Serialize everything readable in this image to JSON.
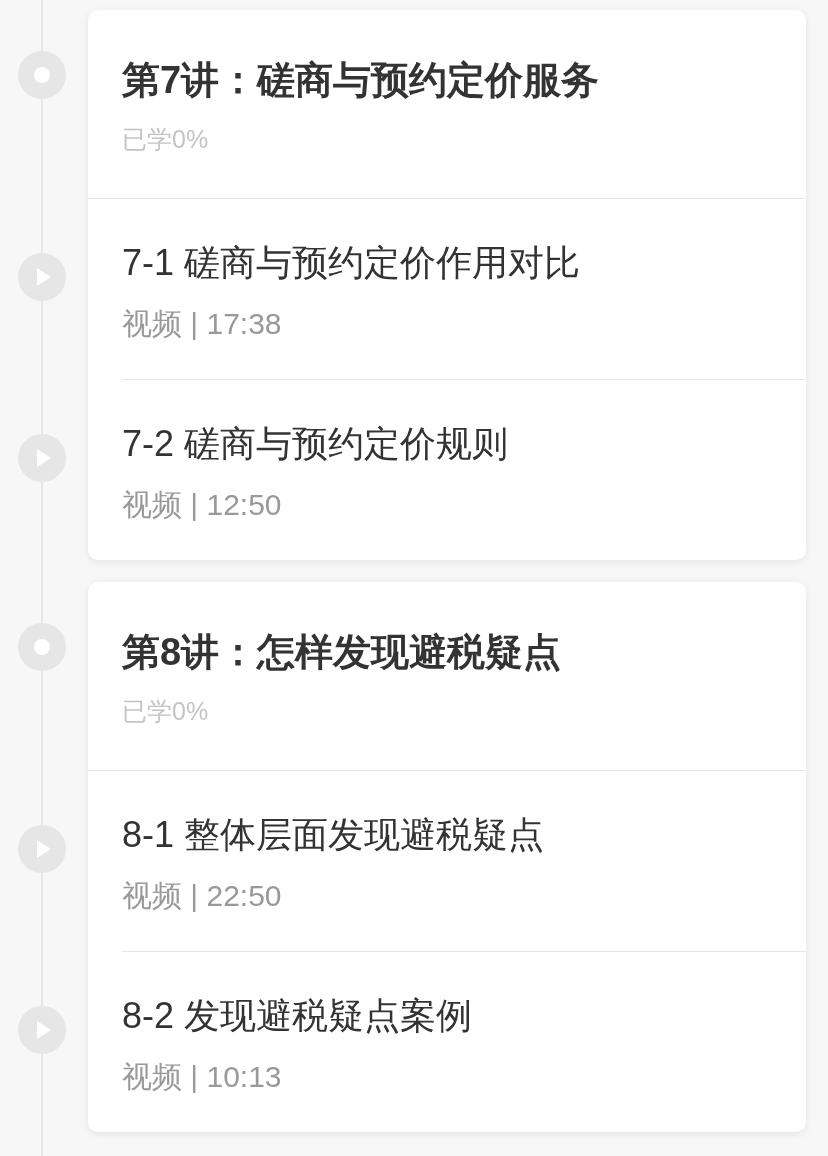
{
  "chapters": [
    {
      "title": "第7讲：磋商与预约定价服务",
      "progress": "已学0%",
      "lessons": [
        {
          "title": "7-1 磋商与预约定价作用对比",
          "meta": "视频 | 17:38",
          "kind": "video"
        },
        {
          "title": "7-2 磋商与预约定价规则",
          "meta": "视频 | 12:50",
          "kind": "video"
        }
      ]
    },
    {
      "title": "第8讲：怎样发现避税疑点",
      "progress": "已学0%",
      "lessons": [
        {
          "title": "8-1 整体层面发现避税疑点",
          "meta": "视频 | 22:50",
          "kind": "video"
        },
        {
          "title": "8-2 发现避税疑点案例",
          "meta": "视频 | 10:13",
          "kind": "video"
        }
      ]
    }
  ]
}
